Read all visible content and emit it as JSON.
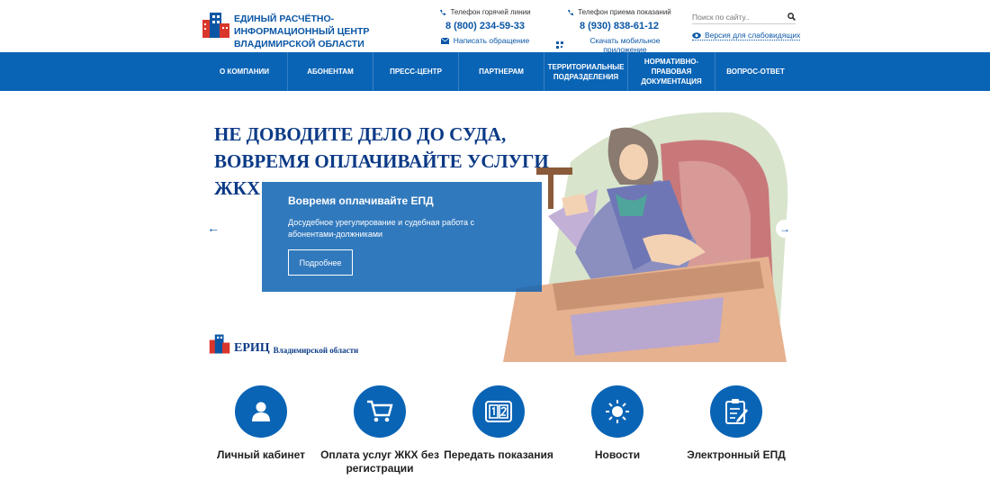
{
  "header": {
    "org_name": "ЕДИНЫЙ РАСЧЁТНО-ИНФОРМАЦИОННЫЙ ЦЕНТР ВЛАДИМИРСКОЙ ОБЛАСТИ",
    "hotline": {
      "label": "Телефон горячей линии",
      "number": "8 (800) 234-59-33",
      "action": "Написать обращение",
      "action_icon": "envelope-icon"
    },
    "readings": {
      "label": "Телефон приема показаний",
      "number": "8 (930) 838-61-12",
      "action": "Скачать мобильное приложение",
      "action_icon": "qr-icon"
    },
    "search": {
      "placeholder": "Поиск по сайту..",
      "icon": "search-icon"
    },
    "low_vision": "Версия для слабовидящих"
  },
  "nav": {
    "items": [
      {
        "label": "О КОМПАНИИ"
      },
      {
        "label": "АБОНЕНТАМ"
      },
      {
        "label": "ПРЕСС-ЦЕНТР"
      },
      {
        "label": "ПАРТНЕРАМ"
      },
      {
        "label": "ТЕРРИТОРИАЛЬНЫЕ ПОДРАЗДЕЛЕНИЯ"
      },
      {
        "label": "НОРМАТИВНО-ПРАВОВАЯ ДОКУМЕНТАЦИЯ"
      },
      {
        "label": "ВОПРОС-ОТВЕТ"
      }
    ]
  },
  "hero": {
    "title": "НЕ ДОВОДИТЕ ДЕЛО ДО СУДА, ВОВРЕМЯ ОПЛАЧИВАЙТЕ УСЛУГИ ЖКХ",
    "slide_title": "Вовремя оплачивайте ЕПД",
    "slide_desc": "Досудебное урегулирование и судебная работа с абонентами-должниками",
    "slide_button": "Подробнее",
    "prev": "←",
    "next": "→",
    "brand_big": "ЕРИЦ",
    "brand_small": "Владимирской области"
  },
  "services": [
    {
      "label": "Личный кабинет",
      "icon": "user-icon"
    },
    {
      "label": "Оплата услуг ЖКХ без регистрации",
      "icon": "cart-icon"
    },
    {
      "label": "Передать показания",
      "icon": "meter-icon"
    },
    {
      "label": "Новости",
      "icon": "sun-icon"
    },
    {
      "label": "Электронный ЕПД",
      "icon": "clipboard-icon"
    }
  ],
  "colors": {
    "primary": "#0a64b5",
    "title_blue": "#0b3a86"
  }
}
